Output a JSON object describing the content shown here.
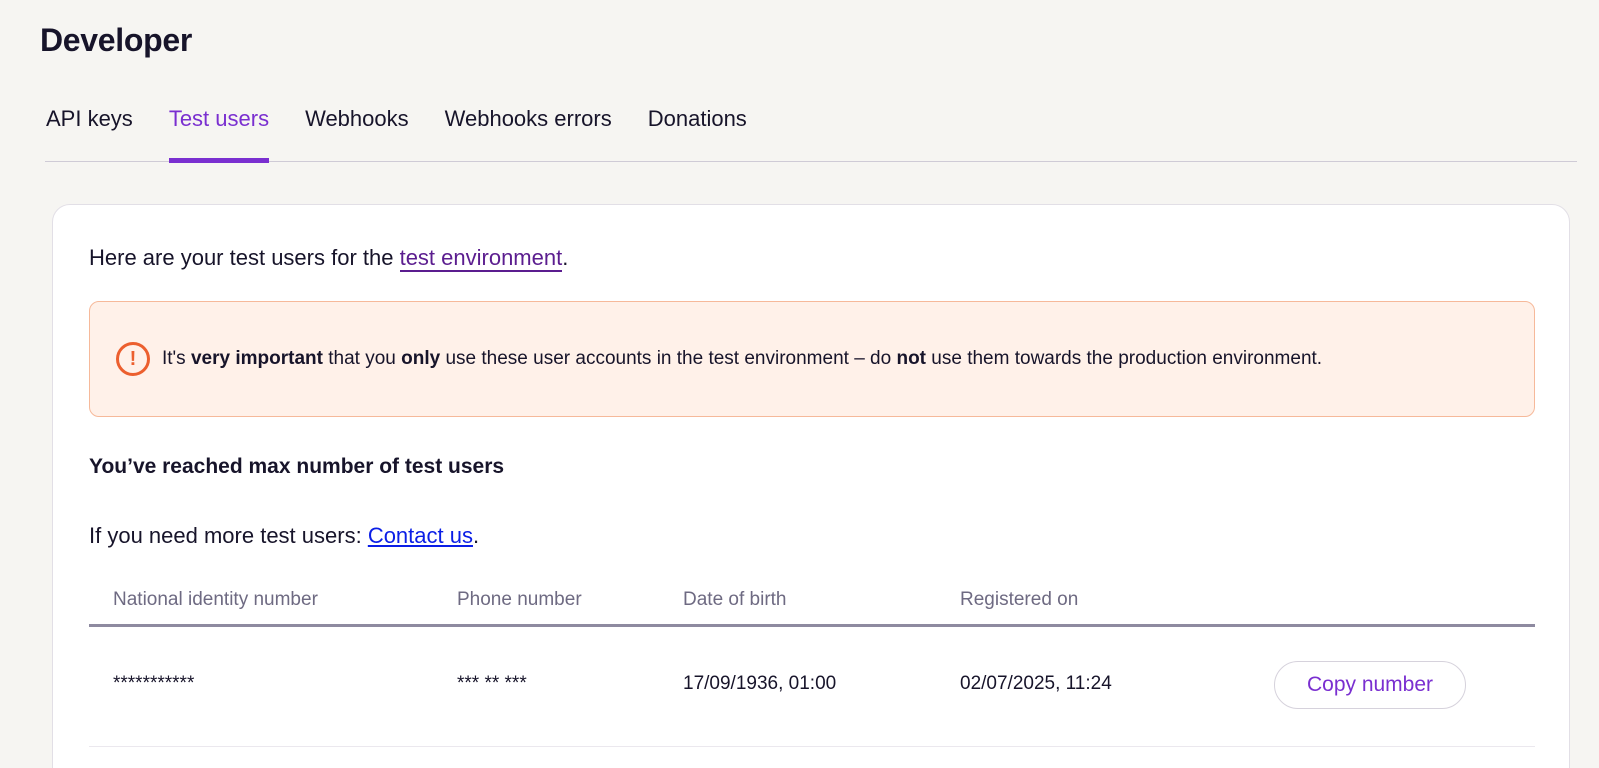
{
  "page": {
    "title": "Developer"
  },
  "tabs": [
    {
      "label": "API keys",
      "active": false
    },
    {
      "label": "Test users",
      "active": true
    },
    {
      "label": "Webhooks",
      "active": false
    },
    {
      "label": "Webhooks errors",
      "active": false
    },
    {
      "label": "Donations",
      "active": false
    }
  ],
  "colors": {
    "accent": "#7a2fd0",
    "warning": "#ec5f2e",
    "alert_bg": "#fff1e9"
  },
  "intro": {
    "prefix": "Here are your test users for the ",
    "link": "test environment",
    "suffix": "."
  },
  "alert": {
    "icon": "exclamation-circle-icon",
    "parts": [
      "It's ",
      "very important",
      " that you ",
      "only",
      " use these user accounts in the test environment – do ",
      "not",
      " use them towards the production environment."
    ]
  },
  "limit": {
    "heading": "You’ve reached max number of test users",
    "more_prefix": "If you need more test users: ",
    "contact_link": "Contact us",
    "more_suffix": "."
  },
  "table": {
    "headers": [
      "National identity number",
      "Phone number",
      "Date of birth",
      "Registered on"
    ],
    "rows": [
      {
        "national_id": "***********",
        "phone": "*** ** ***",
        "dob": "17/09/1936, 01:00",
        "registered": "02/07/2025, 11:24",
        "action": "Copy number"
      }
    ]
  }
}
